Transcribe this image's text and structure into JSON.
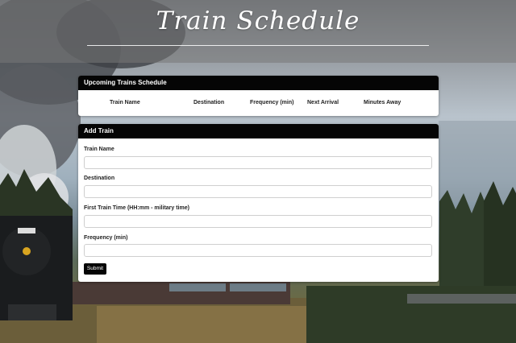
{
  "page": {
    "title": "Train Schedule"
  },
  "schedule": {
    "heading": "Upcoming Trains Schedule",
    "columns": [
      "Train Name",
      "Destination",
      "Frequency (min)",
      "Next Arrival",
      "Minutes Away"
    ]
  },
  "form": {
    "heading": "Add Train",
    "fields": [
      {
        "label": "Train Name",
        "value": ""
      },
      {
        "label": "Destination",
        "value": ""
      },
      {
        "label": "First Train Time (HH:mm - military time)",
        "value": ""
      },
      {
        "label": "Frequency (min)",
        "value": ""
      }
    ],
    "submit_label": "Submit"
  },
  "colors": {
    "panel_heading_bg": "#050505",
    "panel_bg": "#ffffff",
    "button_bg": "#050505"
  }
}
